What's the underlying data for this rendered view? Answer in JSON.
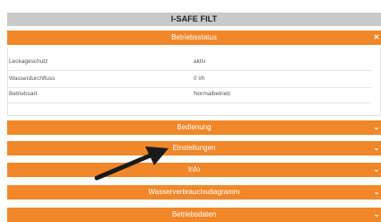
{
  "header": {
    "title": "I-SAFE FILT"
  },
  "status_panel": {
    "label": "Betriebsstatus",
    "close_icon": "close-icon",
    "rows": [
      {
        "label": "Leckageschutz",
        "value": "aktiv"
      },
      {
        "label": "Wasserdurchfluss",
        "value": "0 l/h"
      },
      {
        "label": "Betriebsart",
        "value": "Normalbetrieb"
      }
    ]
  },
  "sections": [
    {
      "label": "Bedienung"
    },
    {
      "label": "Einstellungen"
    },
    {
      "label": "Info"
    },
    {
      "label": "Wasserverbrauchsdiagramm"
    },
    {
      "label": "Betriebsdaten"
    }
  ],
  "colors": {
    "accent": "#f0872a",
    "titlebar": "#c9c9c9",
    "annotation_arrow": "#1a1a1a"
  }
}
